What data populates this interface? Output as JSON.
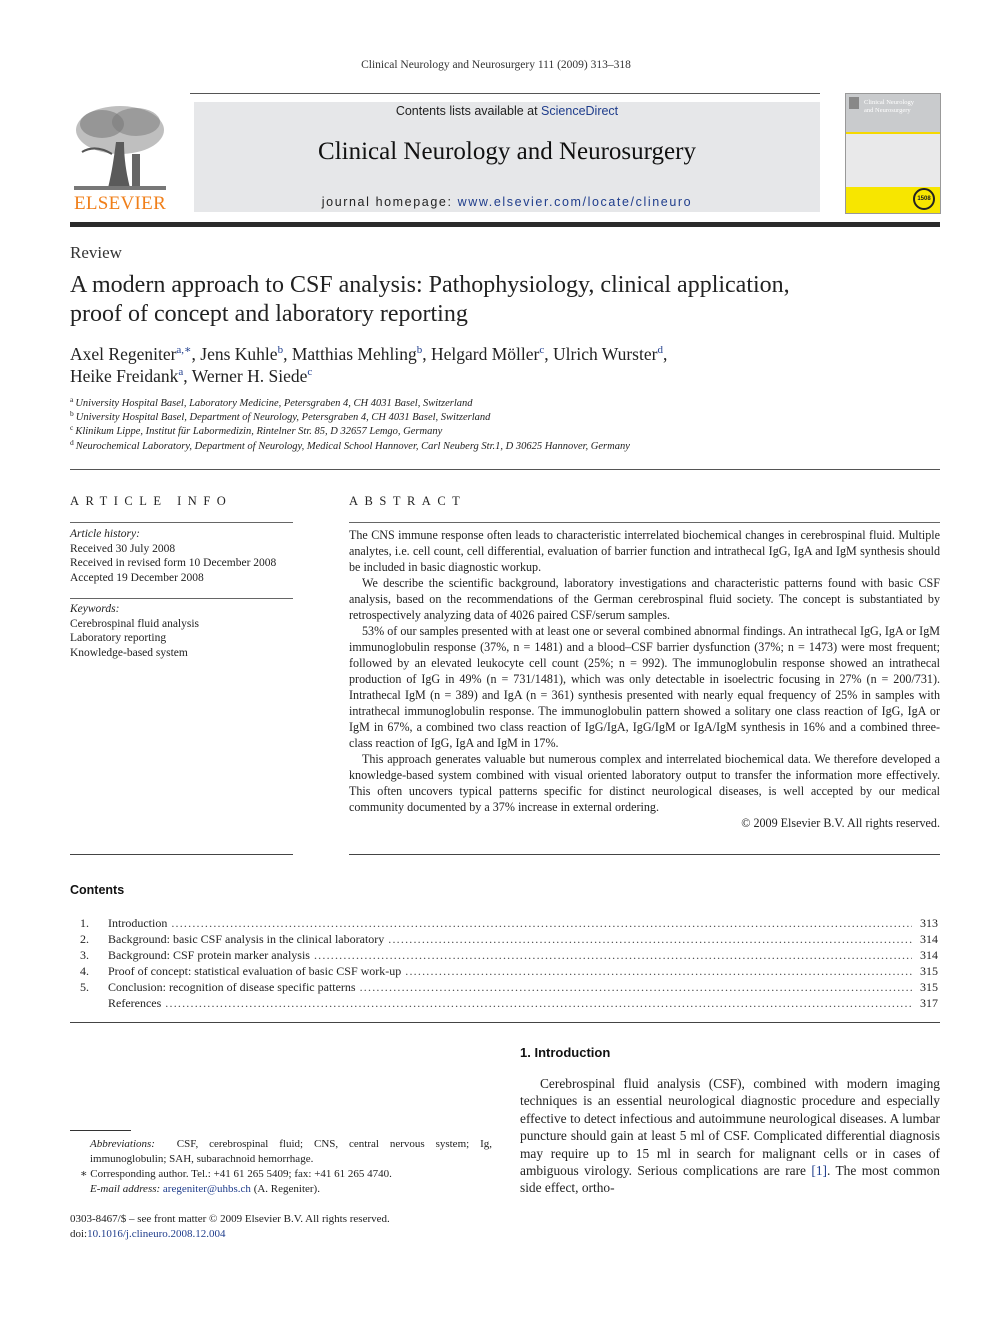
{
  "running_head": "Clinical Neurology and Neurosurgery 111 (2009) 313–318",
  "masthead": {
    "publisher_logo_text": "ELSEVIER",
    "contents_prefix": "Contents lists available at ",
    "contents_link": "ScienceDirect",
    "journal_title": "Clinical Neurology and Neurosurgery",
    "homepage_prefix": "journal homepage: ",
    "homepage_link": "www.elsevier.com/locate/clineuro",
    "cover_title_line1": "Clinical Neurology",
    "cover_title_line2": "and Neurosurgery",
    "cover_badge": "1508",
    "colors": {
      "band": "#e6e7e9",
      "elsevier_orange": "#f07f1a",
      "link_blue": "#1f3d8c",
      "cover_yellow": "#f7e600"
    }
  },
  "article": {
    "type": "Review",
    "title_line1": "A modern approach to CSF analysis: Pathophysiology, clinical application,",
    "title_line2": "proof of concept and laboratory reporting",
    "authors": [
      {
        "name": "Axel Regeniter",
        "sup": "a,∗",
        "sep": ", "
      },
      {
        "name": "Jens Kuhle",
        "sup": "b",
        "sep": ", "
      },
      {
        "name": "Matthias Mehling",
        "sup": "b",
        "sep": ", "
      },
      {
        "name": "Helgard Möller",
        "sup": "c",
        "sep": ", "
      },
      {
        "name": "Ulrich Wurster",
        "sup": "d",
        "sep": ","
      },
      {
        "name": "Heike Freidank",
        "sup": "a",
        "sep": ", "
      },
      {
        "name": "Werner H. Siede",
        "sup": "c",
        "sep": ""
      }
    ],
    "affiliations": [
      {
        "key": "a",
        "text": "University Hospital Basel, Laboratory Medicine, Petersgraben 4, CH 4031 Basel, Switzerland"
      },
      {
        "key": "b",
        "text": "University Hospital Basel, Department of Neurology, Petersgraben 4, CH 4031 Basel, Switzerland"
      },
      {
        "key": "c",
        "text": "Klinikum Lippe, Institut für Labormedizin, Rintelner Str. 85, D 32657 Lemgo, Germany"
      },
      {
        "key": "d",
        "text": "Neurochemical Laboratory, Department of Neurology, Medical School Hannover, Carl Neuberg Str.1, D 30625 Hannover, Germany"
      }
    ]
  },
  "article_info": {
    "heading": "ARTICLE INFO",
    "history_label": "Article history:",
    "history": [
      "Received 30 July 2008",
      "Received in revised form 10 December 2008",
      "Accepted 19 December 2008"
    ],
    "keywords_label": "Keywords:",
    "keywords": [
      "Cerebrospinal fluid analysis",
      "Laboratory reporting",
      "Knowledge-based system"
    ]
  },
  "abstract": {
    "heading": "ABSTRACT",
    "paragraphs": [
      "The CNS immune response often leads to characteristic interrelated biochemical changes in cerebrospinal fluid. Multiple analytes, i.e. cell count, cell differential, evaluation of barrier function and intrathecal IgG, IgA and IgM synthesis should be included in basic diagnostic workup.",
      "We describe the scientific background, laboratory investigations and characteristic patterns found with basic CSF analysis, based on the recommendations of the German cerebrospinal fluid society. The concept is substantiated by retrospectively analyzing data of 4026 paired CSF/serum samples.",
      "53% of our samples presented with at least one or several combined abnormal findings. An intrathecal IgG, IgA or IgM immunoglobulin response (37%, n = 1481) and a blood–CSF barrier dysfunction (37%; n = 1473) were most frequent; followed by an elevated leukocyte cell count (25%; n = 992). The immunoglobulin response showed an intrathecal production of IgG in 49% (n = 731/1481), which was only detectable in isoelectric focusing in 27% (n = 200/731). Intrathecal IgM (n = 389) and IgA (n = 361) synthesis presented with nearly equal frequency of 25% in samples with intrathecal immunoglobulin response. The immunoglobulin pattern showed a solitary one class reaction of IgG, IgA or IgM in 67%, a combined two class reaction of IgG/IgA, IgG/IgM or IgA/IgM synthesis in 16% and a combined three-class reaction of IgG, IgA and IgM in 17%.",
      "This approach generates valuable but numerous complex and interrelated biochemical data. We therefore developed a knowledge-based system combined with visual oriented laboratory output to transfer the information more effectively. This often uncovers typical patterns specific for distinct neurological diseases, is well accepted by our medical community documented by a 37% increase in external ordering."
    ],
    "copyright": "© 2009 Elsevier B.V. All rights reserved."
  },
  "contents": {
    "heading": "Contents",
    "items": [
      {
        "num": "1.",
        "title": "Introduction",
        "page": "313"
      },
      {
        "num": "2.",
        "title": "Background: basic CSF analysis in the clinical laboratory",
        "page": "314"
      },
      {
        "num": "3.",
        "title": "Background: CSF protein marker analysis",
        "page": "314"
      },
      {
        "num": "4.",
        "title": "Proof of concept: statistical evaluation of basic CSF work-up",
        "page": "315"
      },
      {
        "num": "5.",
        "title": "Conclusion: recognition of disease specific patterns",
        "page": "315"
      },
      {
        "num": "",
        "title": "References",
        "page": "317"
      }
    ]
  },
  "introduction": {
    "heading": "1.  Introduction",
    "text_before_ref": "Cerebrospinal fluid analysis (CSF), combined with modern imaging techniques is an essential neurological diagnostic procedure and especially effective to detect infectious and autoimmune neurological diseases. A lumbar puncture should gain at least 5 ml of CSF. Complicated differential diagnosis may require up to 15 ml in search for malignant cells or in cases of ambiguous virology. Serious complications are rare ",
    "ref": "[1]",
    "text_after_ref": ". The most common side effect, ortho-"
  },
  "footnotes": {
    "abbrev_label": "Abbreviations:",
    "abbrev_text": "CSF, cerebrospinal fluid; CNS, central nervous system; Ig, immunoglobulin; SAH, subarachnoid hemorrhage.",
    "corresponding": "∗  Corresponding author. Tel.: +41 61 265 5409; fax: +41 61 265 4740.",
    "email_label": "E-mail address:",
    "email": "aregeniter@uhbs.ch",
    "email_suffix": " (A. Regeniter).",
    "front_matter": "0303-8467/$ – see front matter © 2009 Elsevier B.V. All rights reserved.",
    "doi_label": "doi:",
    "doi": "10.1016/j.clineuro.2008.12.004"
  }
}
